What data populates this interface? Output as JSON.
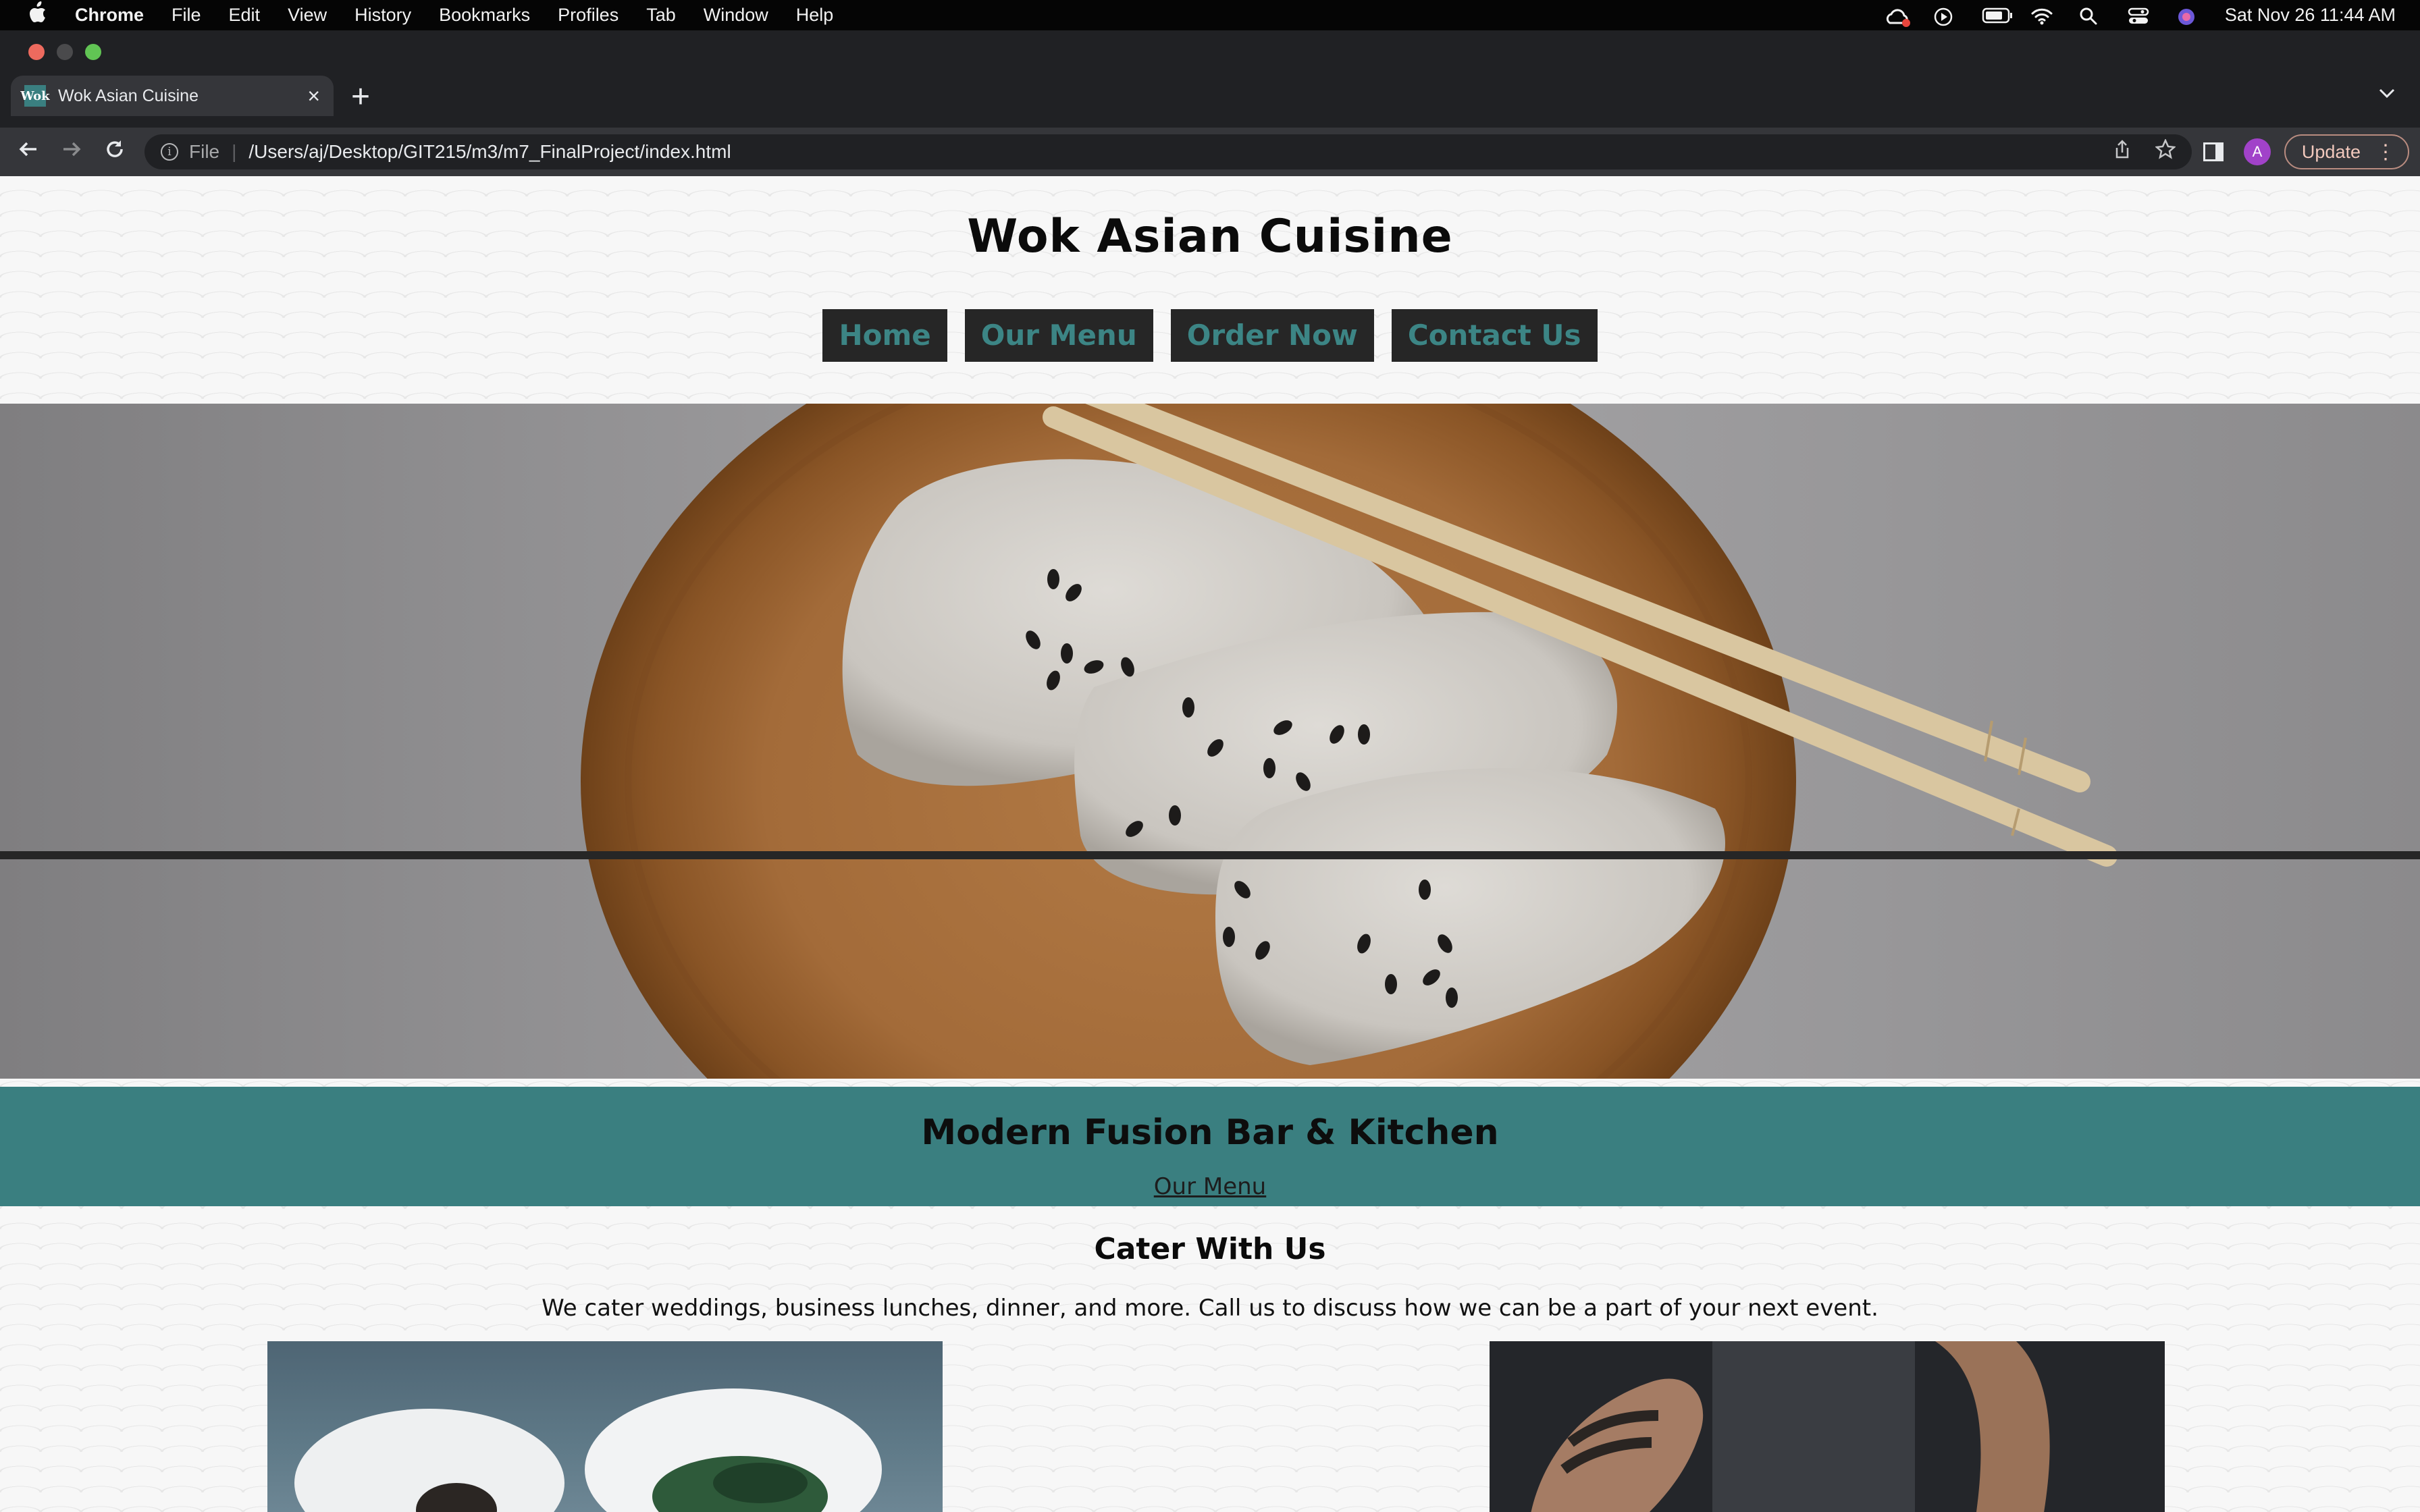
{
  "menubar": {
    "apple": "",
    "app": "Chrome",
    "items": [
      "File",
      "Edit",
      "View",
      "History",
      "Bookmarks",
      "Profiles",
      "Tab",
      "Window",
      "Help"
    ],
    "datetime": "Sat Nov 26  11:44 AM"
  },
  "browser": {
    "tab_title": "Wok Asian Cuisine",
    "favicon_text": "Wok",
    "new_tab": "+",
    "close": "×",
    "scheme": "File",
    "url": "/Users/aj/Desktop/GIT215/m3/m7_FinalProject/index.html",
    "avatar": "A",
    "update_label": "Update"
  },
  "site": {
    "title": "Wok Asian Cuisine",
    "nav": [
      "Home",
      "Our Menu",
      "Order Now",
      "Contact Us"
    ],
    "banner_heading": "Modern Fusion Bar & Kitchen",
    "banner_link": "Our Menu",
    "cater_heading": "Cater With Us",
    "cater_text": "We cater weddings, business lunches, dinner, and more. Call us to discuss how we can be a part of your next event."
  },
  "colors": {
    "accent": "#3a7f80",
    "nav_bg": "#262626"
  }
}
